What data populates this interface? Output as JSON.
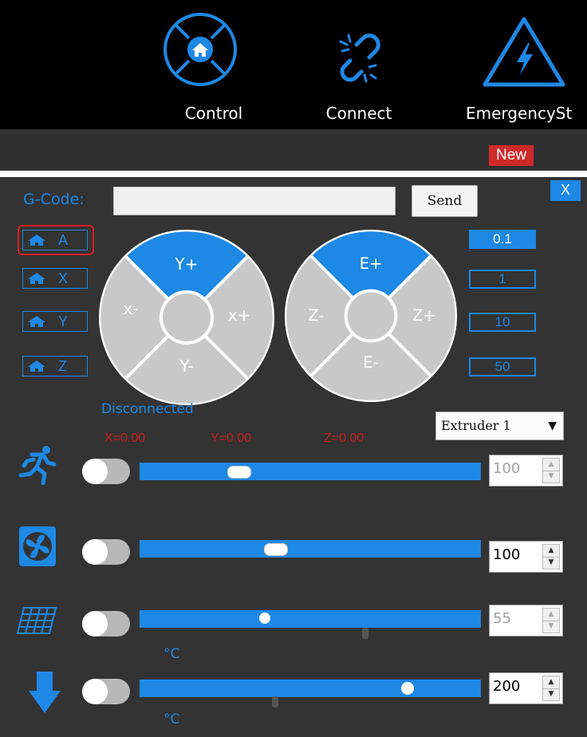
{
  "nav": {
    "items": [
      {
        "label": "Control",
        "icon": "home-cross-icon"
      },
      {
        "label": "Connect",
        "icon": "broken-link-icon"
      },
      {
        "label": "EmergencySt",
        "icon": "warning-bolt-icon"
      }
    ],
    "badge": "New"
  },
  "panel": {
    "close_label": "X",
    "gcode_label": "G-Code:",
    "gcode_value": "",
    "send_label": "Send",
    "home_buttons": [
      "A",
      "X",
      "Y",
      "Z"
    ],
    "xy_pad": {
      "top": "Y+",
      "bottom": "Y-",
      "left": "x-",
      "right": "x+"
    },
    "ze_pad": {
      "top": "E+",
      "bottom": "E-",
      "left": "Z-",
      "right": "Z+"
    },
    "step_values": [
      "0.1",
      "1",
      "10",
      "50"
    ],
    "active_step": "0.1",
    "status": "Disconnected",
    "coords": {
      "x": "X=0.00",
      "y": "Y=0.00",
      "z": "Z=0.00"
    },
    "extruder": {
      "selected": "Extruder 1",
      "arrow": "▼"
    },
    "rows": [
      {
        "name": "speed",
        "icon": "running-man-icon",
        "value": "100",
        "enabled": false,
        "slider_fraction": 0.29
      },
      {
        "name": "fan",
        "icon": "fan-icon",
        "value": "100",
        "enabled": true,
        "slider_fraction": 0.4
      },
      {
        "name": "bed",
        "icon": "heated-bed-icon",
        "value": "55",
        "enabled": false,
        "slider_fraction": 0.37,
        "unit": "°C"
      },
      {
        "name": "nozzle",
        "icon": "down-arrow-icon",
        "value": "200",
        "enabled": true,
        "slider_fraction": 0.79,
        "unit": "°C"
      }
    ]
  },
  "colors": {
    "accent": "#1e88e5",
    "alert": "#d02a2a",
    "coords": "#c81e1e",
    "panel": "#333333"
  }
}
